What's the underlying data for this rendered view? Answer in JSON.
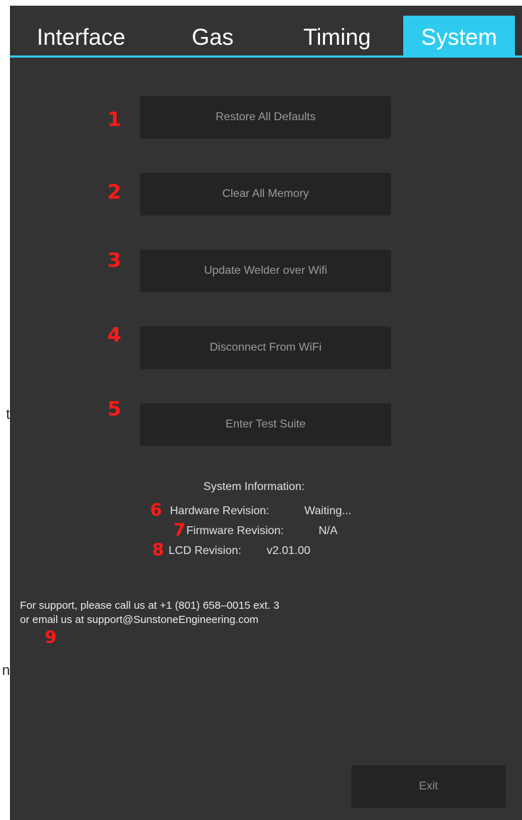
{
  "edge_fragments": [
    "t",
    "n"
  ],
  "tabs": [
    {
      "label": "Interface"
    },
    {
      "label": "Gas"
    },
    {
      "label": "Timing"
    },
    {
      "label": "System"
    }
  ],
  "active_tab": "System",
  "colors": {
    "accent": "#2fcbee",
    "background": "#333333",
    "button": "#242424",
    "marker": "#ff1a1a"
  },
  "buttons": [
    {
      "label": "Restore All Defaults",
      "marker": "1"
    },
    {
      "label": "Clear All Memory",
      "marker": "2"
    },
    {
      "label": "Update Welder over Wifi",
      "marker": "3"
    },
    {
      "label": "Disconnect From WiFi",
      "marker": "4"
    },
    {
      "label": "Enter Test Suite",
      "marker": "5"
    }
  ],
  "system_info": {
    "title": "System Information:",
    "hardware": {
      "marker": "6",
      "label": "Hardware Revision:",
      "value": "Waiting..."
    },
    "firmware": {
      "marker": "7",
      "label": "Firmware Revision:",
      "value": "N/A"
    },
    "lcd": {
      "marker": "8",
      "label": "LCD Revision:",
      "value": "v2.01.00"
    }
  },
  "support": {
    "line1": "For support, please call us at +1 (801) 658–0015 ext. 3",
    "line2": "or email us at support@SunstoneEngineering.com",
    "marker": "9"
  },
  "exit_label": "Exit"
}
